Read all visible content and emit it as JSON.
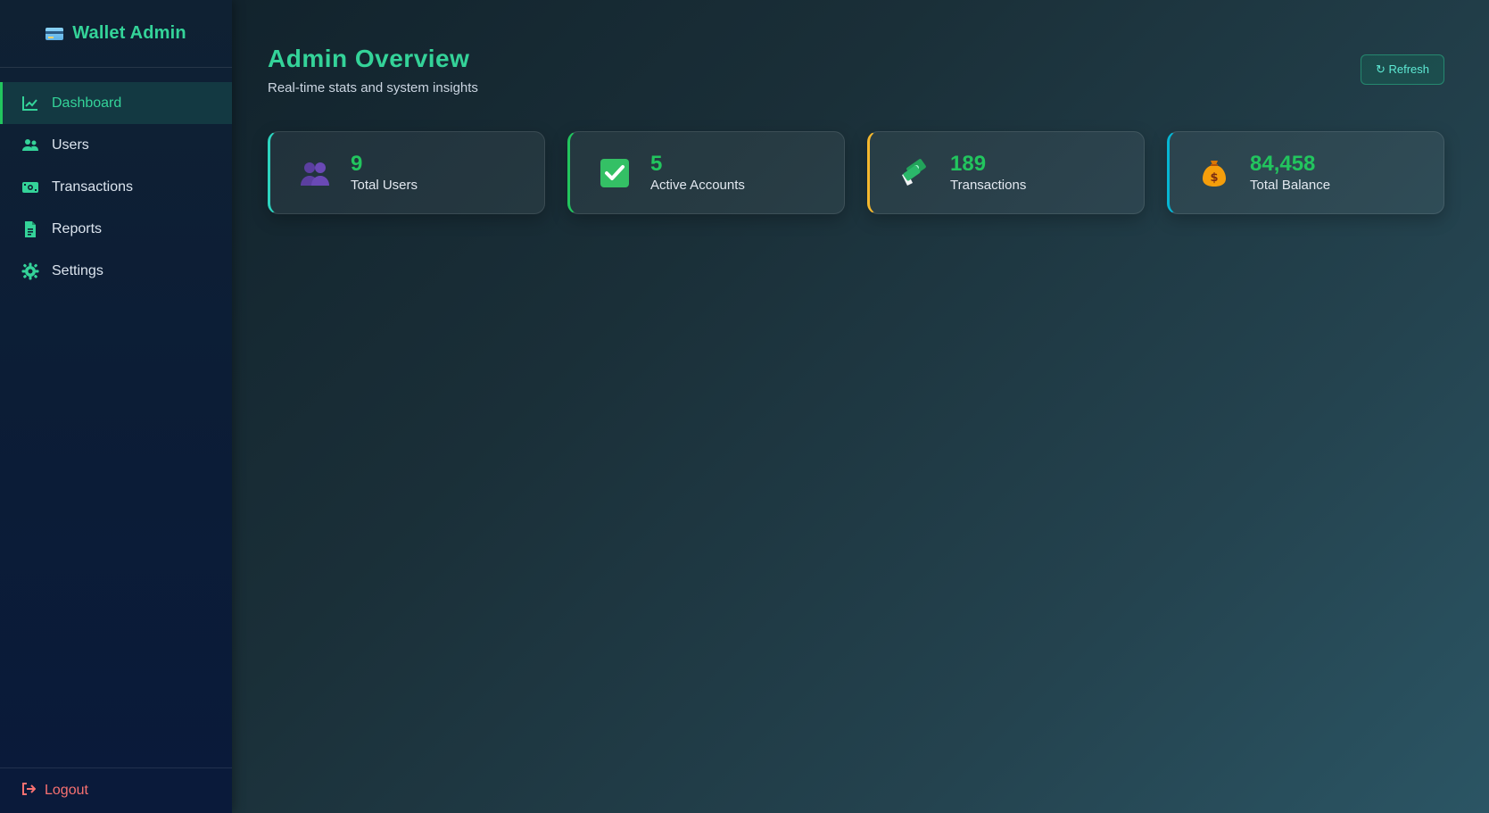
{
  "brand": {
    "title": "Wallet Admin",
    "icon": "credit-card-icon"
  },
  "sidebar": {
    "items": [
      {
        "label": "Dashboard",
        "icon": "chart-line-icon",
        "active": true
      },
      {
        "label": "Users",
        "icon": "users-icon",
        "active": false
      },
      {
        "label": "Transactions",
        "icon": "money-bill-icon",
        "active": false
      },
      {
        "label": "Reports",
        "icon": "file-icon",
        "active": false
      },
      {
        "label": "Settings",
        "icon": "gear-icon",
        "active": false
      }
    ],
    "logout": {
      "label": "Logout",
      "icon": "sign-out-icon"
    }
  },
  "header": {
    "title": "Admin Overview",
    "subtitle": "Real-time stats and system insights",
    "refresh_label": "↻ Refresh"
  },
  "stats": [
    {
      "value": "9",
      "label": "Total Users",
      "icon": "people-icon",
      "accent": "#2dd4bf"
    },
    {
      "value": "5",
      "label": "Active Accounts",
      "icon": "checkmark-icon",
      "accent": "#22c55e"
    },
    {
      "value": "189",
      "label": "Transactions",
      "icon": "flying-money-icon",
      "accent": "#f5b82e"
    },
    {
      "value": "84,458",
      "label": "Total Balance",
      "icon": "money-bag-icon",
      "accent": "#06b6d4"
    }
  ],
  "colors": {
    "accent": "#34d399",
    "value_green": "#22c55e",
    "logout_red": "#f87171"
  }
}
